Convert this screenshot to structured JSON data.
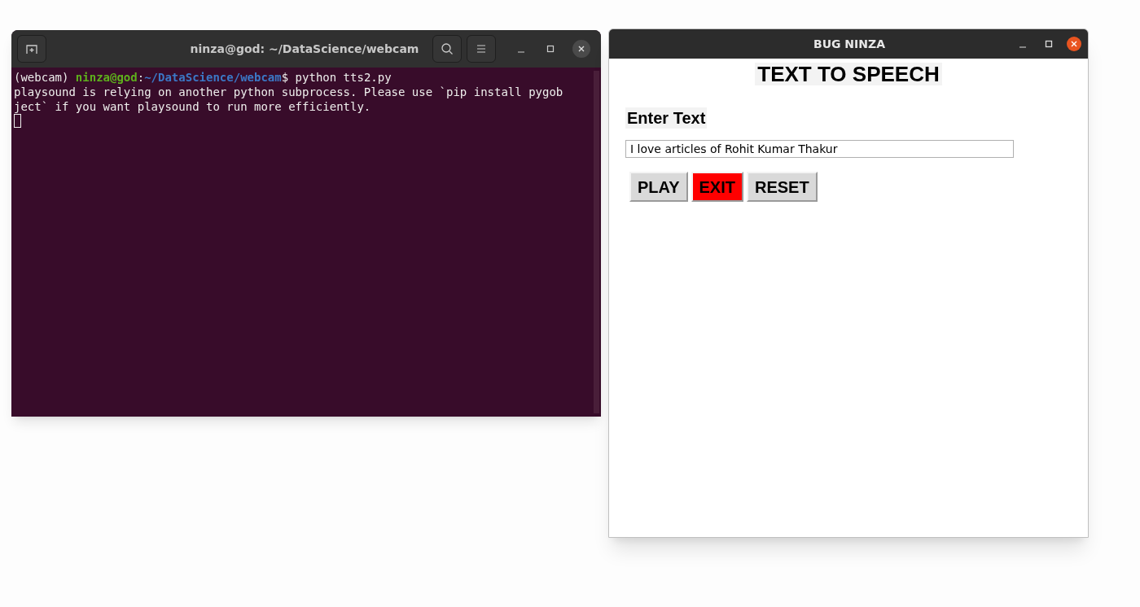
{
  "terminal": {
    "title": "ninza@god: ~/DataScience/webcam",
    "lines": [
      [
        {
          "kind": "plain",
          "text": "(webcam) "
        },
        {
          "kind": "user",
          "text": "ninza@god"
        },
        {
          "kind": "plain",
          "text": ":"
        },
        {
          "kind": "path",
          "text": "~/DataScience/webcam"
        },
        {
          "kind": "plain",
          "text": "$ python tts2.py"
        }
      ],
      [
        {
          "kind": "plain",
          "text": "playsound is relying on another python subprocess. Please use `pip install pygob"
        }
      ],
      [
        {
          "kind": "plain",
          "text": "ject` if you want playsound to run more efficiently."
        }
      ]
    ]
  },
  "app": {
    "title": "BUG NINZA",
    "heading": "TEXT TO SPEECH",
    "label": "Enter Text",
    "input": {
      "value": "I love articles of Rohit Kumar Thakur"
    },
    "buttons": [
      {
        "label": "PLAY",
        "color": "#d9d9d9"
      },
      {
        "label": "EXIT",
        "color": "#ff0000"
      },
      {
        "label": "RESET",
        "color": "#d9d9d9"
      }
    ]
  }
}
